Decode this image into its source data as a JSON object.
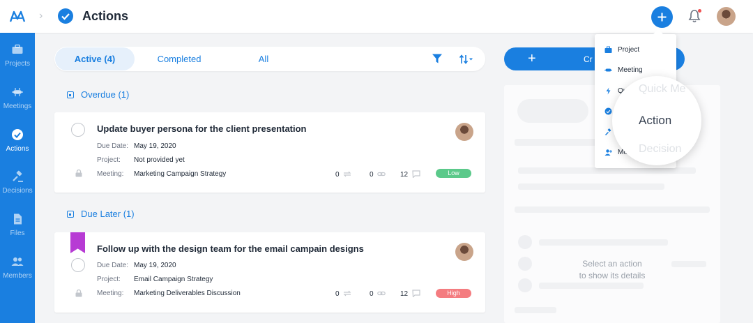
{
  "header": {
    "title": "Actions",
    "add_button_symbol": "+"
  },
  "sidebar": {
    "items": [
      {
        "label": "Projects",
        "icon": "briefcase-icon"
      },
      {
        "label": "Meetings",
        "icon": "meeting-icon"
      },
      {
        "label": "Actions",
        "icon": "check-circle-icon",
        "active": true
      },
      {
        "label": "Decisions",
        "icon": "gavel-icon"
      },
      {
        "label": "Files",
        "icon": "file-icon"
      },
      {
        "label": "Members",
        "icon": "people-icon"
      }
    ]
  },
  "filters": {
    "tabs": [
      {
        "label": "Active (4)",
        "active": true
      },
      {
        "label": "Completed"
      },
      {
        "label": "All"
      }
    ]
  },
  "groups": [
    {
      "heading": "Overdue (1)",
      "items": [
        {
          "title": "Update buyer persona for the client presentation",
          "due_label": "Due Date:",
          "due_value": "May 19, 2020",
          "project_label": "Project:",
          "project_value": "Not provided yet",
          "meeting_label": "Meeting:",
          "meeting_value": "Marketing Campaign Strategy",
          "repeat_count": "0",
          "link_count": "0",
          "comment_count": "12",
          "priority": "Low"
        }
      ]
    },
    {
      "heading": "Due Later (1)",
      "items": [
        {
          "title": "Follow up with the design team for the email campain designs",
          "due_label": "Due Date:",
          "due_value": "May 19, 2020",
          "project_label": "Project:",
          "project_value": "Email Campaign Strategy",
          "meeting_label": "Meeting:",
          "meeting_value": "Marketing Deliverables Discussion",
          "repeat_count": "0",
          "link_count": "0",
          "comment_count": "12",
          "priority": "High"
        }
      ]
    }
  ],
  "create_button": {
    "plus": "+",
    "label": "Cr"
  },
  "detail": {
    "empty_line1": "Select an action",
    "empty_line2": "to show its details"
  },
  "dropdown": {
    "items": [
      {
        "label": "Project",
        "icon": "briefcase-icon"
      },
      {
        "label": "Meeting",
        "icon": "meeting-icon"
      },
      {
        "label": "Qu",
        "icon": "bolt-icon"
      },
      {
        "label": "",
        "icon": "check-circle-icon"
      },
      {
        "label": "",
        "icon": "gavel-icon"
      },
      {
        "label": "Me",
        "icon": "add-person-icon"
      }
    ],
    "magnifier": {
      "above": "Quick Me",
      "main": "Action",
      "below": "Decision"
    }
  },
  "colors": {
    "primary": "#1a7fe0",
    "low": "#5bc98a",
    "high": "#f47c80",
    "bookmark": "#b73bd4"
  }
}
